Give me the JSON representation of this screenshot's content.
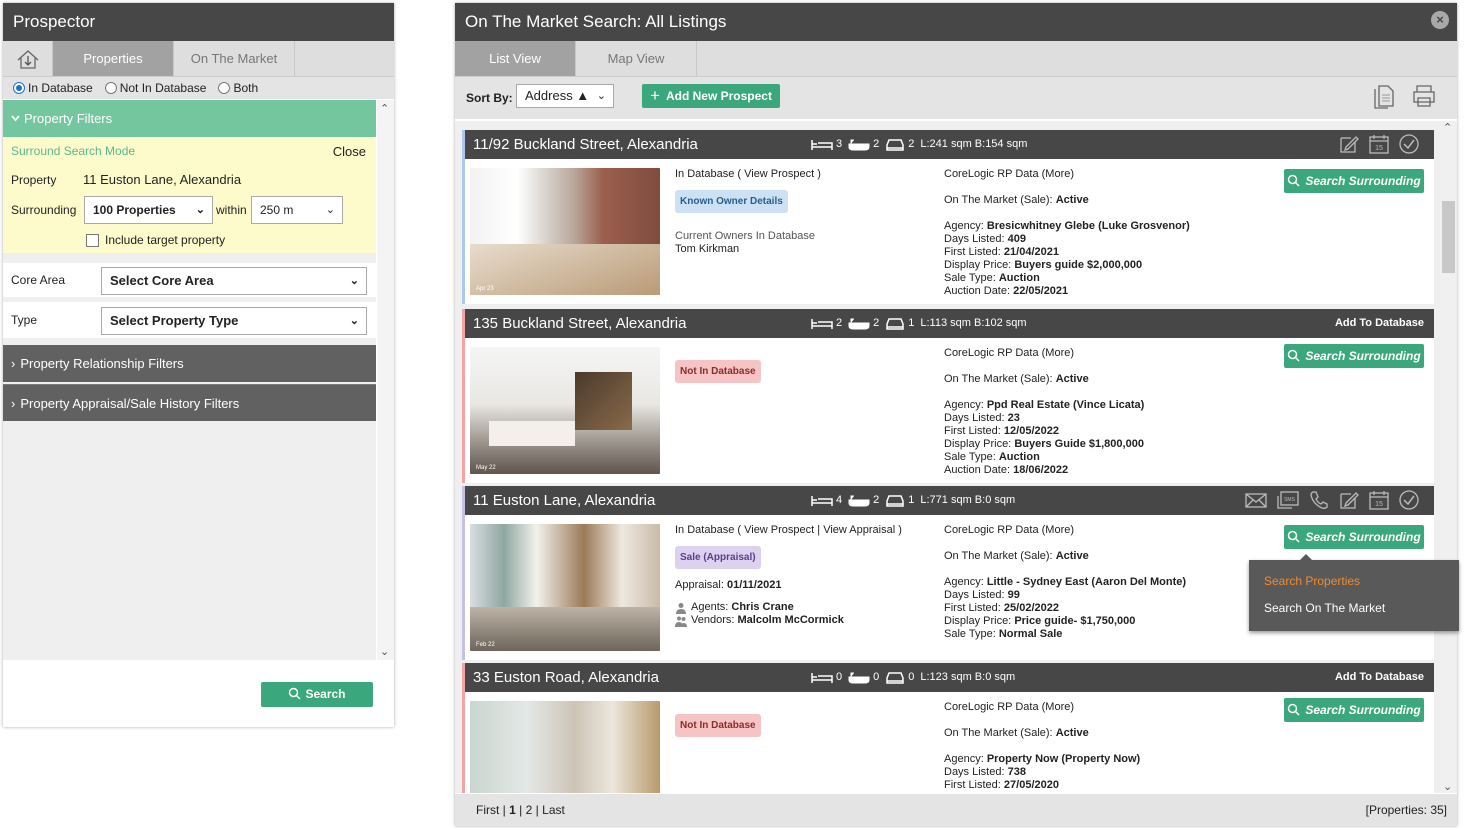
{
  "left": {
    "title": "Prospector",
    "tabs": [
      "Properties",
      "On The Market"
    ],
    "radios": [
      "In Database",
      "Not In Database",
      "Both"
    ],
    "property_filters_label": "Property Filters",
    "surround_mode_label": "Surround Search Mode",
    "close_label": "Close",
    "property_label": "Property",
    "property_value": "11 Euston Lane, Alexandria",
    "surrounding_label": "Surrounding",
    "surrounding_value": "100 Properties",
    "within_label": "within",
    "within_value": "250 m",
    "include_target_label": "Include target property",
    "core_area_label": "Core Area",
    "core_area_value": "Select Core Area",
    "type_label": "Type",
    "type_value": "Select Property Type",
    "relationship_filters_label": "Property Relationship Filters",
    "appraisal_filters_label": "Property Appraisal/Sale History Filters",
    "search_button": "Search"
  },
  "right": {
    "title": "On The Market Search: All Listings",
    "tabs": [
      "List View",
      "Map View"
    ],
    "sort_label": "Sort By:",
    "sort_value": "Address ▲",
    "add_prospect": "Add New Prospect",
    "cards": [
      {
        "address": "11/92 Buckland Street, Alexandria",
        "beds": "3",
        "baths": "2",
        "cars": "2",
        "area": "L:241 sqm B:154 sqm",
        "photo_tag": "Apr 23",
        "db_line_prefix": "In Database (",
        "view_prospect": "View Prospect",
        "db_line_suffix": ")",
        "badge": "Known Owner Details",
        "owners_label": "Current Owners In Database",
        "owner_name": "Tom Kirkman",
        "rp_data": "CoreLogic RP Data (More)",
        "otm_label": "On The Market (Sale):",
        "otm_value": "Active",
        "agency_label": "Agency:",
        "agency": "Bresicwhitney Glebe (Luke Grosvenor)",
        "days_label": "Days Listed:",
        "days": "409",
        "first_label": "First Listed:",
        "first": "21/04/2021",
        "price_label": "Display Price:",
        "price": "Buyers guide $2,000,000",
        "sale_label": "Sale Type:",
        "sale": "Auction",
        "auction_label": "Auction Date:",
        "auction": "22/05/2021",
        "search_btn": "Search Surrounding"
      },
      {
        "address": "135 Buckland Street, Alexandria",
        "beds": "2",
        "baths": "2",
        "cars": "1",
        "area": "L:113 sqm B:102 sqm",
        "photo_tag": "May 22",
        "add_to_db": "Add To Database",
        "badge": "Not In Database",
        "rp_data": "CoreLogic RP Data (More)",
        "otm_label": "On The Market (Sale):",
        "otm_value": "Active",
        "agency_label": "Agency:",
        "agency": "Ppd Real Estate (Vince Licata)",
        "days_label": "Days Listed:",
        "days": "23",
        "first_label": "First Listed:",
        "first": "12/05/2022",
        "price_label": "Display Price:",
        "price": "Buyers Guide $1,800,000",
        "sale_label": "Sale Type:",
        "sale": "Auction",
        "auction_label": "Auction Date:",
        "auction": "18/06/2022",
        "search_btn": "Search Surrounding"
      },
      {
        "address": "11 Euston Lane, Alexandria",
        "beds": "4",
        "baths": "2",
        "cars": "1",
        "area": "L:771 sqm B:0 sqm",
        "photo_tag": "Feb 22",
        "db_line_prefix": "In Database (",
        "view_prospect": "View Prospect",
        "sep": "|",
        "view_appraisal": "View Appraisal",
        "db_line_suffix": ")",
        "badge": "Sale (Appraisal)",
        "appraisal_label": "Appraisal:",
        "appraisal": "01/11/2021",
        "agents_label": "Agents:",
        "agents": "Chris Crane",
        "vendors_label": "Vendors:",
        "vendors": "Malcolm McCormick",
        "rp_data": "CoreLogic RP Data (More)",
        "otm_label": "On The Market (Sale):",
        "otm_value": "Active",
        "agency_label": "Agency:",
        "agency": "Little - Sydney East (Aaron Del Monte)",
        "days_label": "Days Listed:",
        "days": "99",
        "first_label": "First Listed:",
        "first": "25/02/2022",
        "price_label": "Display Price:",
        "price": "Price guide- $1,750,000",
        "sale_label": "Sale Type:",
        "sale": "Normal Sale",
        "search_btn": "Search Surrounding"
      },
      {
        "address": "33 Euston Road, Alexandria",
        "beds": "0",
        "baths": "0",
        "cars": "0",
        "area": "L:123 sqm B:0 sqm",
        "add_to_db": "Add To Database",
        "badge": "Not In Database",
        "rp_data": "CoreLogic RP Data (More)",
        "otm_label": "On The Market (Sale):",
        "otm_value": "Active",
        "agency_label": "Agency:",
        "agency": "Property Now (Property Now)",
        "days_label": "Days Listed:",
        "days": "738",
        "first_label": "First Listed:",
        "first": "27/05/2020",
        "search_btn": "Search Surrounding"
      }
    ],
    "dropdown_menu": [
      "Search Properties",
      "Search On The Market"
    ],
    "pager": {
      "first": "First",
      "sep": "|",
      "p1": "1",
      "p2": "2",
      "last": "Last"
    },
    "count": "[Properties: 35]"
  },
  "colors": {
    "header": "#474747",
    "accent": "#3ba77c",
    "filter_head": "#73c69e",
    "menu_highlight": "#f08a2e"
  }
}
